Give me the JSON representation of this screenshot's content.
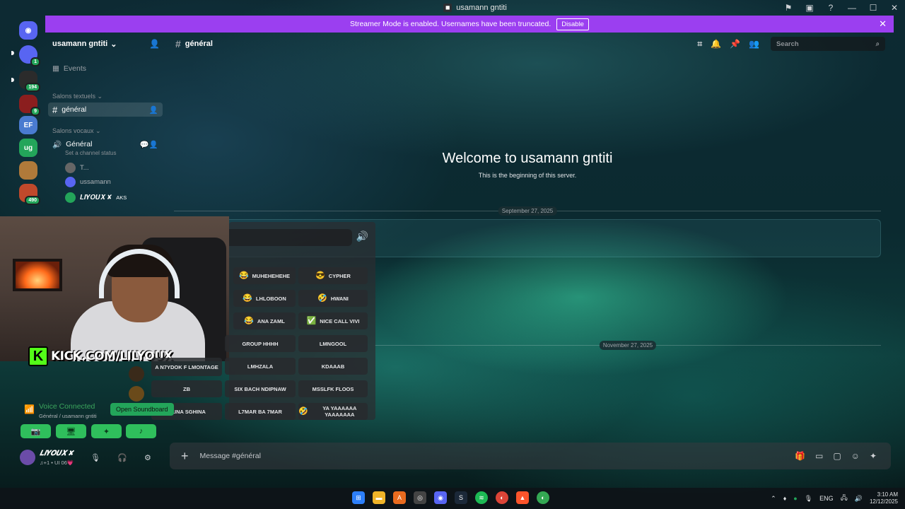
{
  "window": {
    "title": "usamann gntiti"
  },
  "banner": {
    "text": "Streamer Mode is enabled. Usernames have been truncated.",
    "button": "Disable"
  },
  "servers": [
    {
      "label": "",
      "badge": "1",
      "color": "#5865f2"
    },
    {
      "label": "",
      "badge": "194",
      "color": "#2b2b2b"
    },
    {
      "label": "",
      "badge": "9",
      "color": "#8b1e1e"
    },
    {
      "label": "EF",
      "badge": "",
      "color": "#4a7bd0"
    },
    {
      "label": "ug",
      "badge": "",
      "color": "#23a55a"
    },
    {
      "label": "",
      "badge": "",
      "color": "#b07a3a"
    },
    {
      "label": "",
      "badge": "490",
      "color": "#c0492b"
    }
  ],
  "server": {
    "name": "usamann gntiti",
    "events": "Events",
    "text_category": "Salons textuels",
    "voice_category": "Salons vocaux",
    "text_channel": "général",
    "voice_channel": "Général",
    "voice_status": "Set a channel status",
    "voice_users": [
      {
        "name": "T...",
        "tag": ""
      },
      {
        "name": "ussamann",
        "tag": ""
      },
      {
        "name": "𝑳𝑰𝒀𝑶𝑼𝑿 ✘",
        "tag": "AKS"
      }
    ]
  },
  "chat": {
    "channel": "général",
    "search_placeholder": "Search",
    "welcome_title": "Welcome to usamann gntiti",
    "welcome_sub": "This is the beginning of this server.",
    "date1": "September 27, 2025",
    "date2": "November 27, 2025",
    "input_placeholder": "Message #général"
  },
  "stream": {
    "kick_url": "KICK.COM/LILYOUX"
  },
  "soundboard": {
    "sounds": [
      {
        "label": "MUHEHEHEHE",
        "emoji": "😂"
      },
      {
        "label": "CYPHER",
        "emoji": "😎"
      },
      {
        "label": "LHLOBOON",
        "emoji": "😂"
      },
      {
        "label": "HWANI",
        "emoji": "🤣"
      },
      {
        "label": "ANA ZAML",
        "emoji": "😂"
      },
      {
        "label": "NICE CALL VIVI",
        "emoji": "✅"
      },
      {
        "label": "GROUP HHHH",
        "emoji": ""
      },
      {
        "label": "LMNGOOL",
        "emoji": ""
      },
      {
        "label": "A N7YDOK F LMONTAGE",
        "emoji": ""
      },
      {
        "label": "LMHZALA",
        "emoji": ""
      },
      {
        "label": "KDAAAB",
        "emoji": ""
      },
      {
        "label": "ZB",
        "emoji": ""
      },
      {
        "label": "SIX BACH NDIPNAW",
        "emoji": ""
      },
      {
        "label": "MSSLFK FLOOS",
        "emoji": ""
      },
      {
        "label": "BLINA SGHINA",
        "emoji": ""
      },
      {
        "label": "L7MAR BA 7MAR",
        "emoji": ""
      },
      {
        "label": "YA YAAAAAA YAAAAAAA",
        "emoji": "🤣"
      }
    ]
  },
  "voice": {
    "status": "Voice Connected",
    "location": "Général / usamann gntiti",
    "tooltip": "Open Soundboard"
  },
  "user": {
    "name": "𝑳𝑰𝒀𝑶𝑼𝑿 ✘",
    "sub": "♫+1 • UI 06💗"
  },
  "tray": {
    "lang": "ENG",
    "time": "3:10 AM",
    "date": "12/12/2025"
  }
}
